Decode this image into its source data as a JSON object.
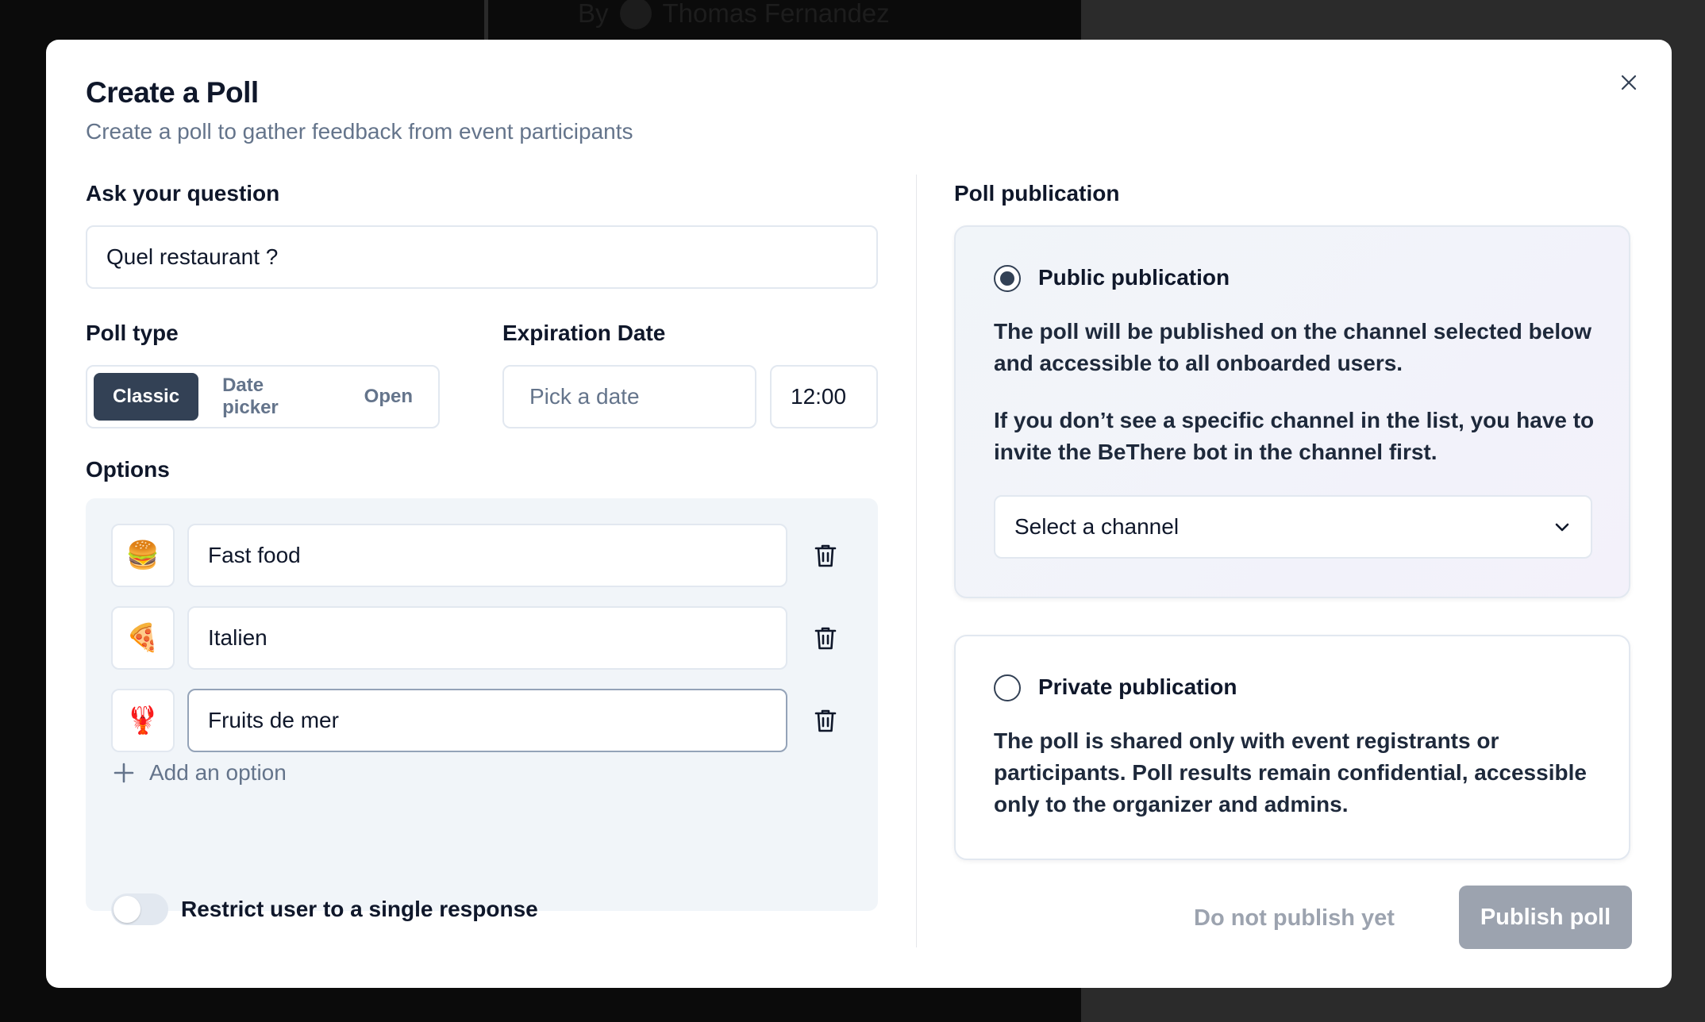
{
  "background": {
    "author_prefix": "By",
    "author_name": "Thomas Fernandez"
  },
  "modal": {
    "title": "Create a Poll",
    "subtitle": "Create a poll to gather feedback from event participants",
    "close_icon": "close-icon"
  },
  "question": {
    "label": "Ask your question",
    "value": "Quel restaurant ?"
  },
  "poll_type": {
    "label": "Poll type",
    "options": [
      "Classic",
      "Date picker",
      "Open"
    ],
    "selected": "Classic"
  },
  "expiration": {
    "label": "Expiration Date",
    "date_placeholder": "Pick a date",
    "time_value": "12:00"
  },
  "options": {
    "label": "Options",
    "items": [
      {
        "emoji": "🍔",
        "value": "Fast food"
      },
      {
        "emoji": "🍕",
        "value": "Italien"
      },
      {
        "emoji": "🦞",
        "value": "Fruits de mer"
      }
    ],
    "add_label": "Add an option",
    "restrict_label": "Restrict user to a single response",
    "restrict_enabled": false
  },
  "publication": {
    "label": "Poll publication",
    "public": {
      "title": "Public publication",
      "text1": "The poll will be published on the channel selected below and accessible to all onboarded users.",
      "text2": "If you don’t see a specific channel in the list, you have to invite the BeThere bot in the channel first.",
      "channel_placeholder": "Select a channel",
      "selected": true
    },
    "private": {
      "title": "Private publication",
      "text": "The poll is shared only with event registrants or participants. Poll results remain confidential, accessible only to the organizer and admins.",
      "selected": false
    }
  },
  "actions": {
    "secondary": "Do not publish yet",
    "primary": "Publish poll"
  },
  "colors": {
    "accent_dark": "#334155",
    "muted_text": "#64748b",
    "panel_bg": "#f1f5f9",
    "disabled_button": "#9ca3af"
  }
}
